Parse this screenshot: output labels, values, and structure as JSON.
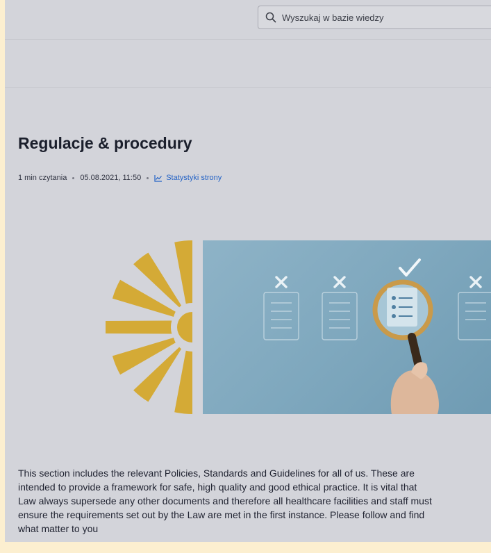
{
  "search": {
    "placeholder": "Wyszukaj w bazie wiedzy",
    "icon": "search-icon"
  },
  "page": {
    "title": "Regulacje & procedury",
    "meta": {
      "read_time": "1 min czytania",
      "date": "05.08.2021, 11:50",
      "stats_label": "Statystyki strony",
      "stats_icon": "line-chart-icon"
    }
  },
  "content": {
    "lines": [
      "This section includes the relevant Policies,  Standards and Guidelines for all of us. These are",
      "intended to provide a framework for safe, high quality and good ethical practice. It is vital that",
      "Law always supersede any other documents and therefore all healthcare facilities and staff must",
      "ensure the requirements set out by the Law are met in the first instance. Please follow and find",
      "what matter to you"
    ]
  },
  "colors": {
    "accent_link": "#2563c6",
    "sun_gold": "#d4aa36",
    "photo_blue": "#8eb3c7",
    "backdrop_cream": "#fcefd0"
  }
}
